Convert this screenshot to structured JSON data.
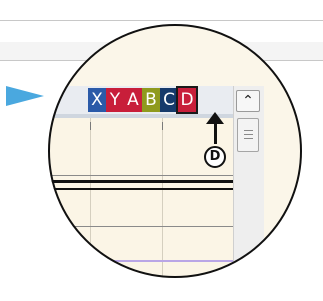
{
  "window": {
    "title": ""
  },
  "badges": {
    "x": "X",
    "y": "Y",
    "a": "A",
    "b": "B",
    "c": "C",
    "d": "D"
  },
  "callout": {
    "label": "D"
  },
  "scrollbar": {
    "up_icon": "chevron-up-icon",
    "up_glyph": "⌃"
  },
  "colors": {
    "x_badge": "#2b5aa8",
    "red_badge": "#c81e3a",
    "b_badge": "#8f9a1e",
    "c_badge": "#163a6b",
    "arrow": "#4aa8df"
  }
}
